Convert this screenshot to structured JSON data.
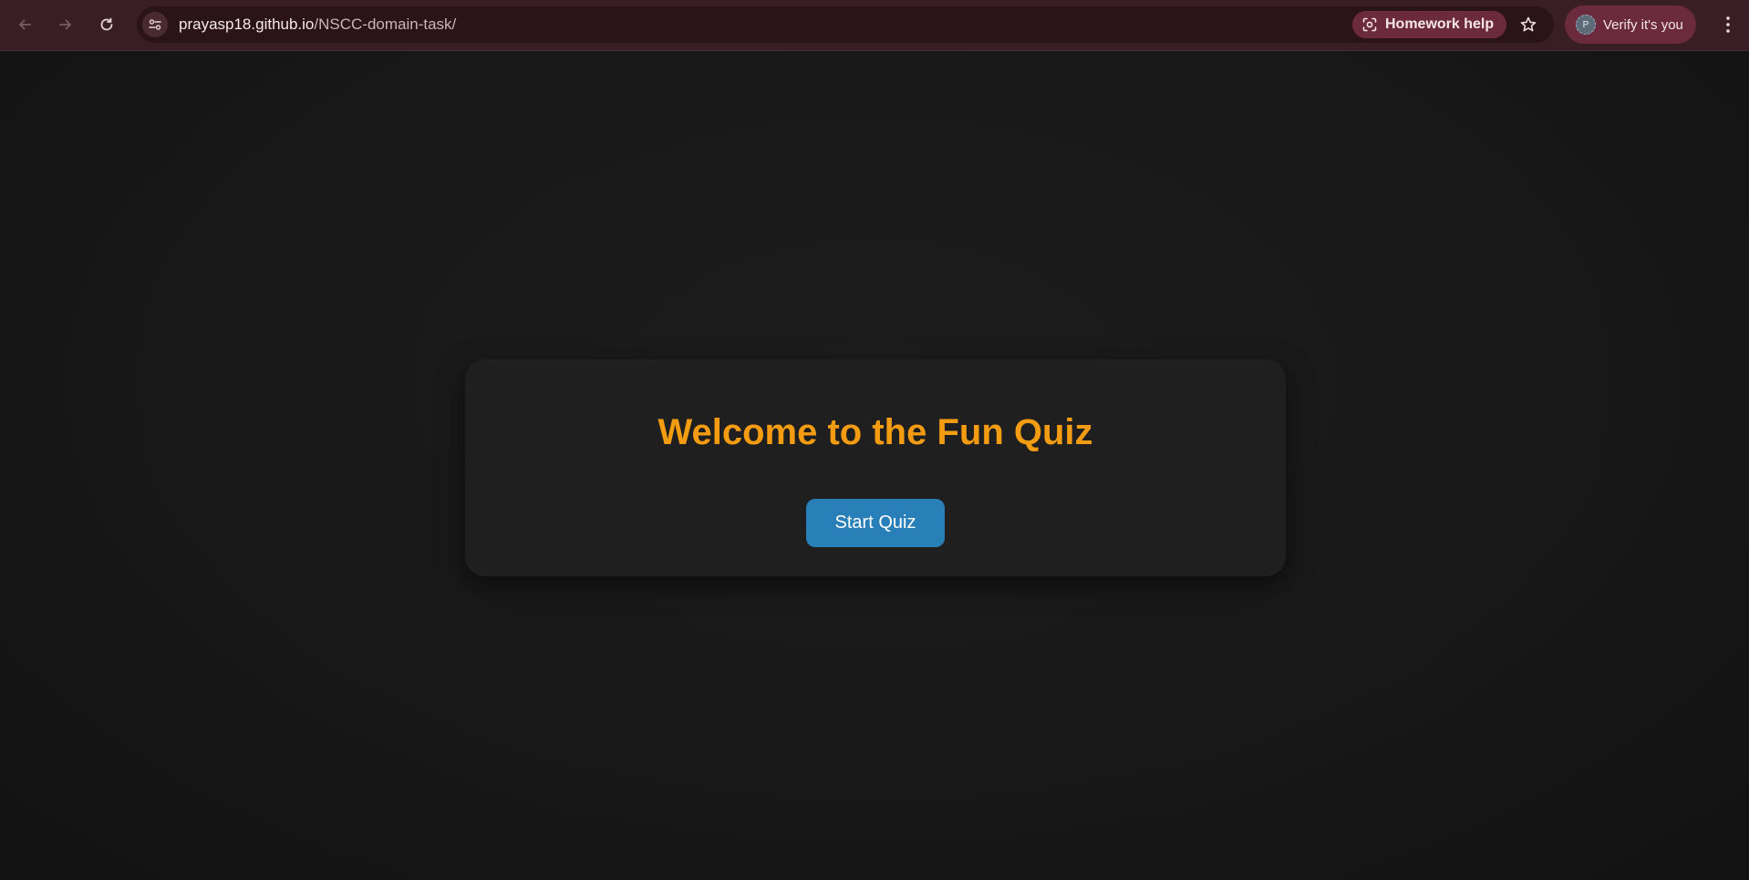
{
  "browser": {
    "url_host": "prayasp18.github.io",
    "url_path": "/NSCC-domain-task/",
    "homework_chip_label": "Homework help",
    "profile_label": "Verify it's you",
    "profile_initial": "P",
    "icons": {
      "back": "back-arrow-icon",
      "forward": "forward-arrow-icon",
      "reload": "reload-icon",
      "site_info": "site-info-icon",
      "homework": "lens-icon",
      "star": "star-icon",
      "menu": "kebab-menu-icon"
    },
    "colors": {
      "toolbar": "#3a1e26",
      "omnibox": "#2a1419",
      "chip": "#6b2a3d"
    }
  },
  "quiz": {
    "title": "Welcome to the Fun Quiz",
    "start_label": "Start Quiz",
    "colors": {
      "title": "#f39c12",
      "button": "#2980b9",
      "card": "#1f1f1f"
    }
  }
}
